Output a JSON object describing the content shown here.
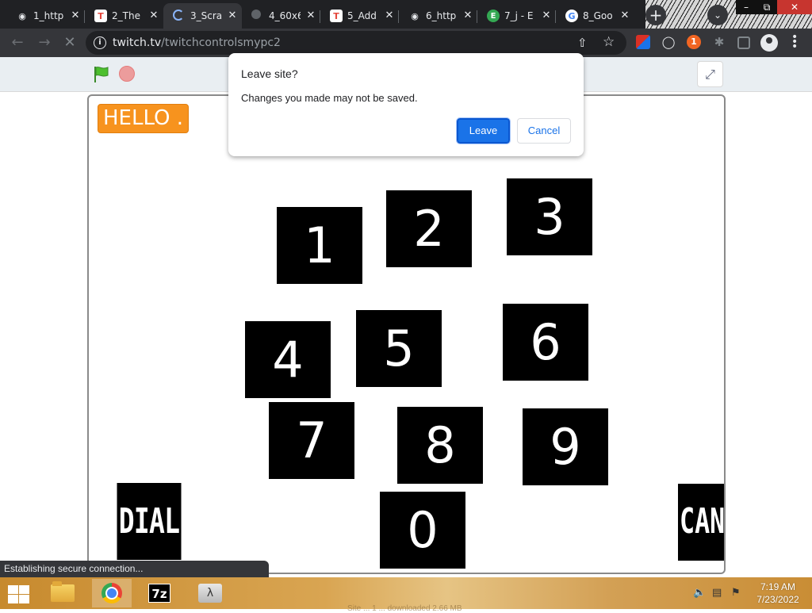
{
  "browser": {
    "tabs": [
      {
        "favicon": "github-icon",
        "title": "1_http"
      },
      {
        "favicon": "t-logo-icon",
        "title": "2_The"
      },
      {
        "favicon": "loading-spinner-icon",
        "title": "3_Scra"
      },
      {
        "favicon": "globe-icon",
        "title": "4_60x6"
      },
      {
        "favicon": "t-logo-icon",
        "title": "5_Add"
      },
      {
        "favicon": "github-icon",
        "title": "6_http"
      },
      {
        "favicon": "e-logo-icon",
        "title": "7_j - E"
      },
      {
        "favicon": "google-icon",
        "title": "8_Goo"
      }
    ],
    "active_tab_index": 2,
    "new_tab_symbol": "+",
    "url_host": "twitch.tv",
    "url_path": "/twitchcontrolsmypc2",
    "extension_badge": "1",
    "status_text": "Establishing secure connection..."
  },
  "dialog": {
    "title": "Leave site?",
    "message": "Changes you made may not be saved.",
    "leave_label": "Leave",
    "cancel_label": "Cancel"
  },
  "stage": {
    "hello_label": "HELLO .",
    "keys": [
      {
        "label": "1"
      },
      {
        "label": "2"
      },
      {
        "label": "3"
      },
      {
        "label": "4"
      },
      {
        "label": "5"
      },
      {
        "label": "6"
      },
      {
        "label": "7"
      },
      {
        "label": "8"
      },
      {
        "label": "9"
      },
      {
        "label": "0"
      }
    ],
    "dial_label": "DIAL",
    "cancel_label": "CANC"
  },
  "taskbar": {
    "time": "7:19 AM",
    "date": "7/23/2022",
    "sevenzip_label": "7z",
    "lambda_label": "λ",
    "faint_text": "Site ... 1 ... downloaded 2.66 MB"
  },
  "colors": {
    "hello_button": "#f7931e",
    "dialog_primary": "#1a73e8",
    "tab_strip": "#202124",
    "toolbar": "#35363a"
  }
}
